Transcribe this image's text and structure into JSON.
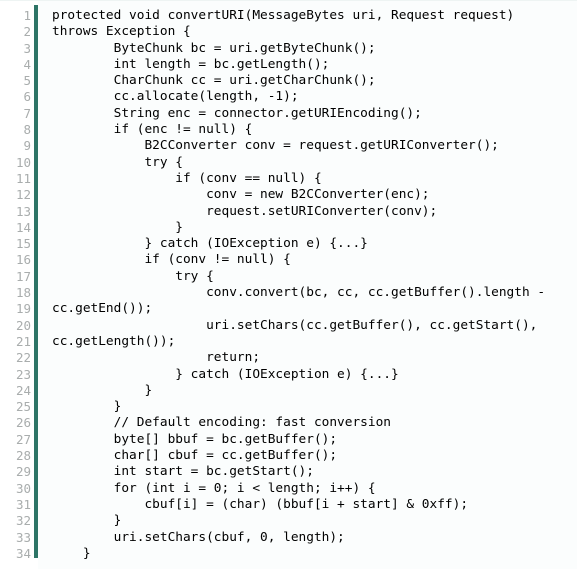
{
  "listing": {
    "language": "java",
    "method_name": "convertURI",
    "first_line_number": 1,
    "last_line_number": 34,
    "total_lines": 34,
    "colors": {
      "background": "#ffffff",
      "code_panel": "#fbfdfd",
      "gutter_rule": "#2d7466",
      "line_number_text": "#a9adad",
      "code_text": "#000000"
    },
    "lines": [
      {
        "number": "1",
        "text": "protected void convertURI(MessageBytes uri, Request request)"
      },
      {
        "number": "2",
        "text": "throws Exception {"
      },
      {
        "number": "3",
        "text": "        ByteChunk bc = uri.getByteChunk();"
      },
      {
        "number": "4",
        "text": "        int length = bc.getLength();"
      },
      {
        "number": "5",
        "text": "        CharChunk cc = uri.getCharChunk();"
      },
      {
        "number": "6",
        "text": "        cc.allocate(length, -1);"
      },
      {
        "number": "7",
        "text": "        String enc = connector.getURIEncoding();"
      },
      {
        "number": "8",
        "text": "        if (enc != null) {"
      },
      {
        "number": "9",
        "text": "            B2CConverter conv = request.getURIConverter();"
      },
      {
        "number": "10",
        "text": "            try {"
      },
      {
        "number": "11",
        "text": "                if (conv == null) {"
      },
      {
        "number": "12",
        "text": "                    conv = new B2CConverter(enc);"
      },
      {
        "number": "13",
        "text": "                    request.setURIConverter(conv);"
      },
      {
        "number": "14",
        "text": "                }"
      },
      {
        "number": "15",
        "text": "            } catch (IOException e) {...}"
      },
      {
        "number": "16",
        "text": "            if (conv != null) {"
      },
      {
        "number": "17",
        "text": "                try {"
      },
      {
        "number": "18",
        "text": "                    conv.convert(bc, cc, cc.getBuffer().length -"
      },
      {
        "number": "19",
        "text": "cc.getEnd());"
      },
      {
        "number": "20",
        "text": "                    uri.setChars(cc.getBuffer(), cc.getStart(),"
      },
      {
        "number": "21",
        "text": "cc.getLength());"
      },
      {
        "number": "22",
        "text": "                    return;"
      },
      {
        "number": "23",
        "text": "                } catch (IOException e) {...}"
      },
      {
        "number": "24",
        "text": "            }"
      },
      {
        "number": "25",
        "text": "        }"
      },
      {
        "number": "26",
        "text": "        // Default encoding: fast conversion"
      },
      {
        "number": "27",
        "text": "        byte[] bbuf = bc.getBuffer();"
      },
      {
        "number": "28",
        "text": "        char[] cbuf = cc.getBuffer();"
      },
      {
        "number": "29",
        "text": "        int start = bc.getStart();"
      },
      {
        "number": "30",
        "text": "        for (int i = 0; i < length; i++) {"
      },
      {
        "number": "31",
        "text": "            cbuf[i] = (char) (bbuf[i + start] & 0xff);"
      },
      {
        "number": "32",
        "text": "        }"
      },
      {
        "number": "33",
        "text": "        uri.setChars(cbuf, 0, length);"
      },
      {
        "number": "34",
        "text": "    }"
      }
    ]
  }
}
